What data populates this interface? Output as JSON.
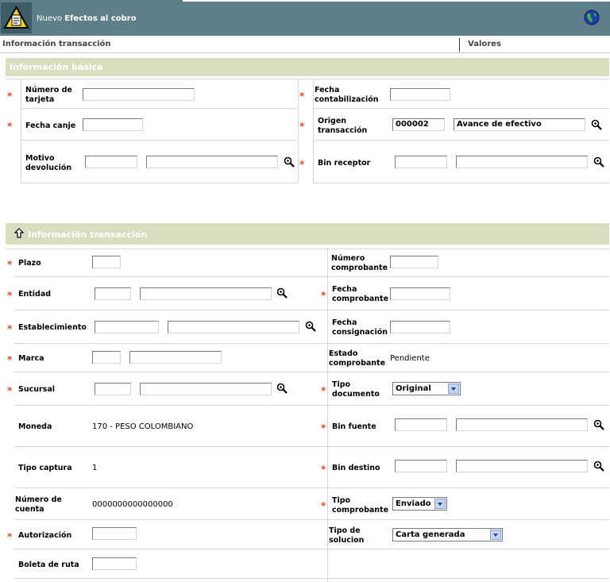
{
  "header": {
    "prefix": "Nuevo",
    "title": "Efectos al cobro"
  },
  "columns": {
    "left": "Información transacción",
    "right": "Valores"
  },
  "sections": {
    "basic": "Información básica",
    "transaction": "Información transacción"
  },
  "basic": {
    "numero_tarjeta": {
      "label_l1": "Número de",
      "label_l2": "tarjeta"
    },
    "fecha_contabilizacion": {
      "label_l1": "Fecha",
      "label_l2": "contabilización"
    },
    "fecha_canje": {
      "label": "Fecha canje"
    },
    "origen_transaccion": {
      "label_l1": "Origen",
      "label_l2": "transacción",
      "code": "000002",
      "name": "Avance de efectivo"
    },
    "motivo_devolucion": {
      "label_l1": "Motivo",
      "label_l2": "devolución"
    },
    "bin_receptor": {
      "label": "Bin receptor"
    }
  },
  "transaction": {
    "plazo": {
      "label": "Plazo"
    },
    "numero_comprobante": {
      "label_l1": "Número",
      "label_l2": "comprobante"
    },
    "entidad": {
      "label": "Entidad"
    },
    "fecha_comprobante": {
      "label_l1": "Fecha",
      "label_l2": "comprobante"
    },
    "establecimiento": {
      "label": "Establecimiento"
    },
    "fecha_consignacion": {
      "label_l1": "Fecha",
      "label_l2": "consignación"
    },
    "marca": {
      "label": "Marca"
    },
    "estado_comprobante": {
      "label_l1": "Estado",
      "label_l2": "comprobante",
      "value": "Pendiente"
    },
    "sucursal": {
      "label": "Sucursal"
    },
    "tipo_documento": {
      "label_l1": "Tipo",
      "label_l2": "documento",
      "selected": "Original"
    },
    "moneda": {
      "label": "Moneda",
      "value": "170 - PESO COLOMBIANO"
    },
    "bin_fuente": {
      "label": "Bin fuente"
    },
    "tipo_captura": {
      "label": "Tipo captura",
      "value": "1"
    },
    "bin_destino": {
      "label": "Bin destino"
    },
    "numero_cuenta": {
      "label_l1": "Número de",
      "label_l2": "cuenta",
      "value": "0000000000000000"
    },
    "tipo_comprobante": {
      "label_l1": "Tipo",
      "label_l2": "comprobante",
      "selected": "Enviado"
    },
    "autorizacion": {
      "label": "Autorización"
    },
    "tipo_solucion": {
      "label_l1": "Tipo de",
      "label_l2": "solucion",
      "selected": "Carta generada"
    },
    "boleta_ruta": {
      "label": "Boleta de ruta"
    }
  },
  "required_mark": "*",
  "icons": {
    "logo": "warning-document-icon",
    "globe": "globe-icon",
    "lookup": "magnifier-icon",
    "collapse": "up-arrow-icon"
  },
  "colors": {
    "header_bg": "#5c7f88",
    "section_bg": "#d7dfbe",
    "required": "#e04a1f"
  }
}
